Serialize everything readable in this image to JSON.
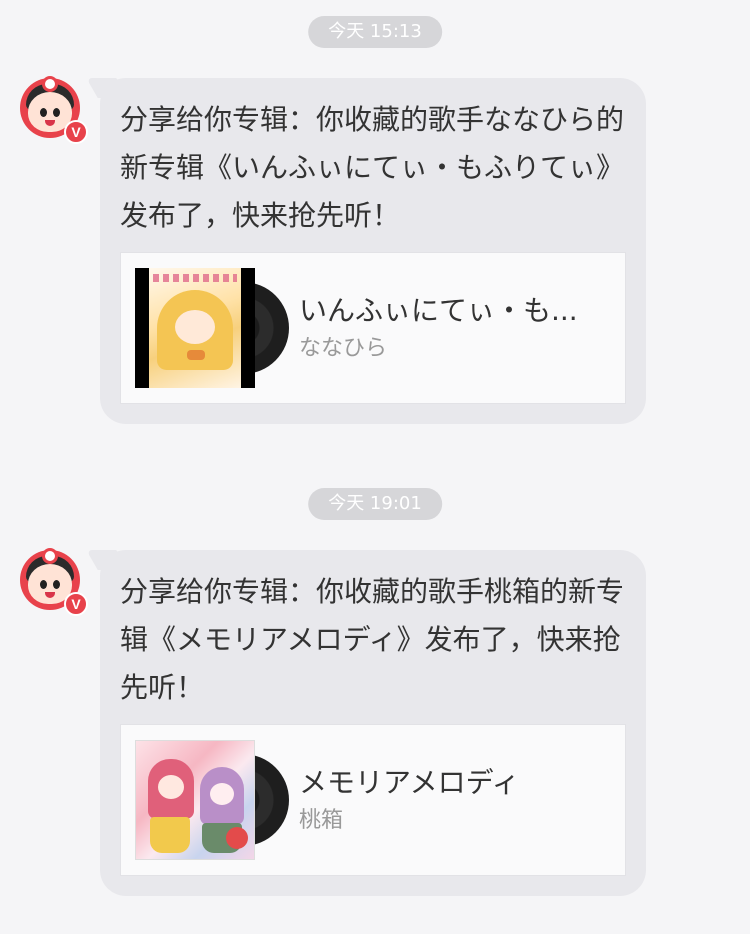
{
  "messages": [
    {
      "timestamp": "今天 15:13",
      "avatar_badge": "V",
      "text": "分享给你专辑：你收藏的歌手ななひら的新专辑《いんふぃにてぃ・もふりてぃ》发布了，快来抢先听！",
      "album": {
        "title": "いんふぃにてぃ・も...",
        "artist": "ななひら"
      }
    },
    {
      "timestamp": "今天 19:01",
      "avatar_badge": "V",
      "text": "分享给你专辑：你收藏的歌手桃箱的新专辑《メモリアメロディ》发布了，快来抢先听！",
      "album": {
        "title": "メモリアメロディ",
        "artist": "桃箱"
      }
    }
  ],
  "colors": {
    "background": "#f5f5f7",
    "bubble": "#e8e8ec",
    "timestamp_pill": "#d6d6d9",
    "avatar_red": "#e8424b",
    "artist_gray": "#999999"
  },
  "icons": [
    "avatar-icon",
    "verified-v-badge",
    "vinyl-disc-icon"
  ]
}
